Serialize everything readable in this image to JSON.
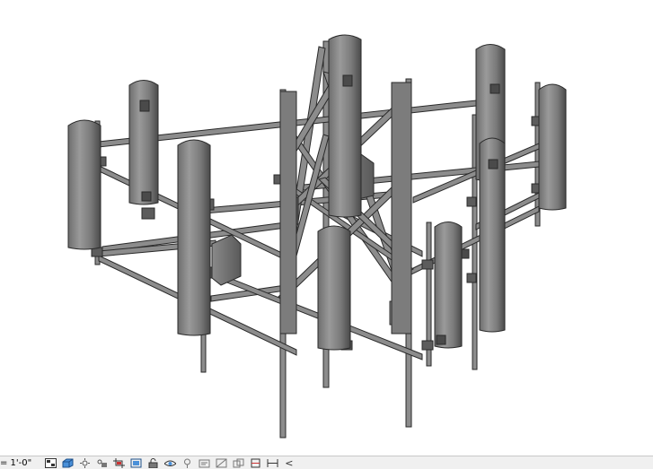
{
  "status_bar": {
    "view_scale": "= 1'-0\"",
    "controls": [
      "detail-level-icon",
      "visual-style-icon",
      "sun-path-icon",
      "shadows-icon",
      "crop-view-icon",
      "show-crop-region-icon",
      "unlock-3d-view-icon",
      "temporary-hide-isolate-icon",
      "reveal-hidden-elements-icon",
      "temporary-view-properties-icon",
      "show-analytical-model-icon",
      "highlight-displacement-icon",
      "reveal-constraints-icon",
      "crop-2d-icon"
    ],
    "collapse_arrow": "<"
  }
}
